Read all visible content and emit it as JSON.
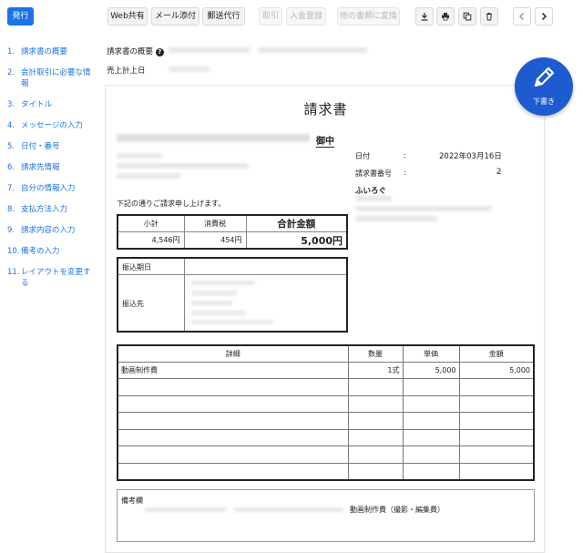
{
  "toolbar": {
    "issue_label": "発行",
    "web_share_label": "Web共有",
    "mail_attach_label": "メール添付",
    "mail_service_label": "郵送代行",
    "transaction_label": "取引",
    "payment_register_label": "入金登録",
    "convert_label": "他の書類に変換",
    "download_icon": "download-icon",
    "print_icon": "print-icon",
    "copy_icon": "copy-icon",
    "delete_icon": "trash-icon",
    "prev_icon": "chevron-left-icon",
    "next_icon": "chevron-right-icon"
  },
  "sidebar": {
    "items": [
      {
        "num": "1.",
        "label": "請求書の概要"
      },
      {
        "num": "2.",
        "label": "会計取引に必要な情報"
      },
      {
        "num": "3.",
        "label": "タイトル"
      },
      {
        "num": "4.",
        "label": "メッセージの入力"
      },
      {
        "num": "5.",
        "label": "日付・番号"
      },
      {
        "num": "6.",
        "label": "請求先情報"
      },
      {
        "num": "7.",
        "label": "自分の情報入力"
      },
      {
        "num": "8.",
        "label": "支払方法入力"
      },
      {
        "num": "9.",
        "label": "請求内容の入力"
      },
      {
        "num": "10.",
        "label": "備考の入力"
      },
      {
        "num": "11.",
        "label": "レイアウトを変更する"
      }
    ]
  },
  "summary": {
    "overview_label": "請求書の概要",
    "sales_date_label": "売上計上日"
  },
  "fab": {
    "label": "下書き",
    "icon": "pencil-icon"
  },
  "document": {
    "title": "請求書",
    "honorific": "御中",
    "date_label": "日付",
    "date_value": "2022年03月16日",
    "number_label": "請求書番号",
    "number_value": "2",
    "colon": ":",
    "sender_name": "ふいろぐ",
    "message": "下記の通りご請求申し上げます。",
    "totals": {
      "subtotal_label": "小計",
      "tax_label": "消費税",
      "grand_label": "合計金額",
      "subtotal_value": "4,546円",
      "tax_value": "454円",
      "grand_value": "5,000円"
    },
    "bank": {
      "due_label": "振込期日",
      "account_label": "振込先"
    },
    "details": {
      "headers": [
        "詳細",
        "数量",
        "単価",
        "金額"
      ],
      "rows": [
        [
          "動画制作費",
          "1式",
          "5,000",
          "5,000"
        ],
        [
          "",
          "",
          "",
          ""
        ],
        [
          "",
          "",
          "",
          ""
        ],
        [
          "",
          "",
          "",
          ""
        ],
        [
          "",
          "",
          "",
          ""
        ],
        [
          "",
          "",
          "",
          ""
        ],
        [
          "",
          "",
          "",
          ""
        ]
      ]
    },
    "notes": {
      "label": "備考欄",
      "text": "動画制作費（撮影・編集費）"
    }
  }
}
